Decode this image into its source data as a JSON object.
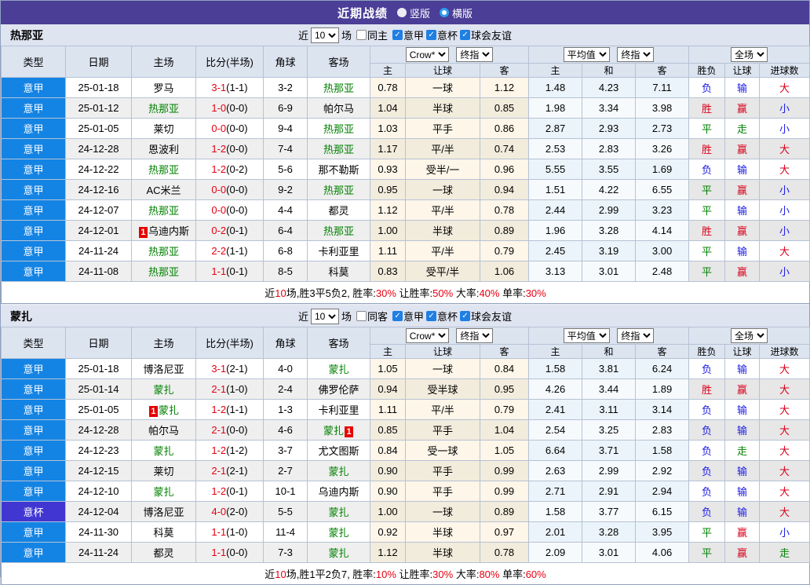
{
  "title_bar": {
    "title": "近期战绩",
    "options": [
      {
        "label": "竖版",
        "selected": true
      },
      {
        "label": "横版",
        "selected": false
      }
    ]
  },
  "table_header": {
    "cols": {
      "type": "类型",
      "date": "日期",
      "home": "主场",
      "score": "比分(半场)",
      "corners": "角球",
      "away": "客场"
    },
    "selects": {
      "crow": "Crow*",
      "final_1": "终指",
      "avg": "平均值",
      "final_2": "终指",
      "full": "全场"
    },
    "sub": {
      "c1": "主",
      "c2": "让球",
      "c3": "客",
      "c4": "主",
      "c5": "和",
      "c6": "客",
      "c7": "胜负",
      "c8": "让球",
      "c9": "进球数"
    }
  },
  "colors": {
    "title_bg": "#4a3e97",
    "focus_team": "#008000",
    "score_red": "#e60012",
    "result_red": "#d9001b",
    "result_blue": "#1a1ae6",
    "result_green": "#008000"
  },
  "league_colors": {
    "意甲": "#1484e4",
    "意杯": "#4236d2"
  },
  "result_colors": {
    "胜": "red",
    "赢": "red",
    "大": "red",
    "负": "blue",
    "输": "blue",
    "小": "blue",
    "平": "green",
    "走": "green"
  },
  "sections": [
    {
      "team": "热那亚",
      "filter": {
        "near": "近",
        "count": "10",
        "games": "场",
        "side_label": "同主",
        "side_checked": false,
        "leagues": [
          {
            "label": "意甲",
            "checked": true
          },
          {
            "label": "意杯",
            "checked": true
          },
          {
            "label": "球会友谊",
            "checked": true
          }
        ]
      },
      "rows": [
        {
          "league": "意甲",
          "date": "25-01-18",
          "home": {
            "name": "罗马",
            "focus": false
          },
          "score": "3-1",
          "half": "(1-1)",
          "corners": "3-2",
          "away": {
            "name": "热那亚",
            "focus": true
          },
          "odds": {
            "home": "0.78",
            "handicap": "一球",
            "away": "1.12"
          },
          "avg": {
            "home": "1.48",
            "draw": "4.23",
            "away": "7.11"
          },
          "results": [
            "负",
            "输",
            "大"
          ]
        },
        {
          "league": "意甲",
          "date": "25-01-12",
          "home": {
            "name": "热那亚",
            "focus": true
          },
          "score": "1-0",
          "half": "(0-0)",
          "corners": "6-9",
          "away": {
            "name": "帕尔马",
            "focus": false
          },
          "odds": {
            "home": "1.04",
            "handicap": "半球",
            "away": "0.85"
          },
          "avg": {
            "home": "1.98",
            "draw": "3.34",
            "away": "3.98"
          },
          "results": [
            "胜",
            "赢",
            "小"
          ]
        },
        {
          "league": "意甲",
          "date": "25-01-05",
          "home": {
            "name": "莱切",
            "focus": false
          },
          "score": "0-0",
          "half": "(0-0)",
          "corners": "9-4",
          "away": {
            "name": "热那亚",
            "focus": true
          },
          "odds": {
            "home": "1.03",
            "handicap": "平手",
            "away": "0.86"
          },
          "avg": {
            "home": "2.87",
            "draw": "2.93",
            "away": "2.73"
          },
          "results": [
            "平",
            "走",
            "小"
          ]
        },
        {
          "league": "意甲",
          "date": "24-12-28",
          "home": {
            "name": "恩波利",
            "focus": false
          },
          "score": "1-2",
          "half": "(0-0)",
          "corners": "7-4",
          "away": {
            "name": "热那亚",
            "focus": true
          },
          "odds": {
            "home": "1.17",
            "handicap": "平/半",
            "away": "0.74"
          },
          "avg": {
            "home": "2.53",
            "draw": "2.83",
            "away": "3.26"
          },
          "results": [
            "胜",
            "赢",
            "大"
          ]
        },
        {
          "league": "意甲",
          "date": "24-12-22",
          "home": {
            "name": "热那亚",
            "focus": true
          },
          "score": "1-2",
          "half": "(0-2)",
          "corners": "5-6",
          "away": {
            "name": "那不勒斯",
            "focus": false
          },
          "odds": {
            "home": "0.93",
            "handicap": "受半/一",
            "away": "0.96"
          },
          "avg": {
            "home": "5.55",
            "draw": "3.55",
            "away": "1.69"
          },
          "results": [
            "负",
            "输",
            "大"
          ]
        },
        {
          "league": "意甲",
          "date": "24-12-16",
          "home": {
            "name": "AC米兰",
            "focus": false
          },
          "score": "0-0",
          "half": "(0-0)",
          "corners": "9-2",
          "away": {
            "name": "热那亚",
            "focus": true
          },
          "odds": {
            "home": "0.95",
            "handicap": "一球",
            "away": "0.94"
          },
          "avg": {
            "home": "1.51",
            "draw": "4.22",
            "away": "6.55"
          },
          "results": [
            "平",
            "赢",
            "小"
          ]
        },
        {
          "league": "意甲",
          "date": "24-12-07",
          "home": {
            "name": "热那亚",
            "focus": true
          },
          "score": "0-0",
          "half": "(0-0)",
          "corners": "4-4",
          "away": {
            "name": "都灵",
            "focus": false
          },
          "odds": {
            "home": "1.12",
            "handicap": "平/半",
            "away": "0.78"
          },
          "avg": {
            "home": "2.44",
            "draw": "2.99",
            "away": "3.23"
          },
          "results": [
            "平",
            "输",
            "小"
          ]
        },
        {
          "league": "意甲",
          "date": "24-12-01",
          "home": {
            "name": "乌迪内斯",
            "focus": false,
            "card": "1",
            "card_pos": "before"
          },
          "score": "0-2",
          "half": "(0-1)",
          "corners": "6-4",
          "away": {
            "name": "热那亚",
            "focus": true
          },
          "odds": {
            "home": "1.00",
            "handicap": "半球",
            "away": "0.89"
          },
          "avg": {
            "home": "1.96",
            "draw": "3.28",
            "away": "4.14"
          },
          "results": [
            "胜",
            "赢",
            "小"
          ]
        },
        {
          "league": "意甲",
          "date": "24-11-24",
          "home": {
            "name": "热那亚",
            "focus": true
          },
          "score": "2-2",
          "half": "(1-1)",
          "corners": "6-8",
          "away": {
            "name": "卡利亚里",
            "focus": false
          },
          "odds": {
            "home": "1.11",
            "handicap": "平/半",
            "away": "0.79"
          },
          "avg": {
            "home": "2.45",
            "draw": "3.19",
            "away": "3.00"
          },
          "results": [
            "平",
            "输",
            "大"
          ]
        },
        {
          "league": "意甲",
          "date": "24-11-08",
          "home": {
            "name": "热那亚",
            "focus": true
          },
          "score": "1-1",
          "half": "(0-1)",
          "corners": "8-5",
          "away": {
            "name": "科莫",
            "focus": false
          },
          "odds": {
            "home": "0.83",
            "handicap": "受平/半",
            "away": "1.06"
          },
          "avg": {
            "home": "3.13",
            "draw": "3.01",
            "away": "2.48"
          },
          "results": [
            "平",
            "赢",
            "小"
          ]
        }
      ],
      "summary": [
        {
          "text": "近"
        },
        {
          "text": "10",
          "red": true
        },
        {
          "text": "场,胜3平5负2, 胜率:"
        },
        {
          "text": "30%",
          "red": true
        },
        {
          "text": " 让胜率:"
        },
        {
          "text": "50%",
          "red": true
        },
        {
          "text": " 大率:"
        },
        {
          "text": "40%",
          "red": true
        },
        {
          "text": " 单率:"
        },
        {
          "text": "30%",
          "red": true
        }
      ]
    },
    {
      "team": "蒙扎",
      "filter": {
        "near": "近",
        "count": "10",
        "games": "场",
        "side_label": "同客",
        "side_checked": false,
        "leagues": [
          {
            "label": "意甲",
            "checked": true
          },
          {
            "label": "意杯",
            "checked": true
          },
          {
            "label": "球会友谊",
            "checked": true
          }
        ]
      },
      "rows": [
        {
          "league": "意甲",
          "date": "25-01-18",
          "home": {
            "name": "博洛尼亚",
            "focus": false
          },
          "score": "3-1",
          "half": "(2-1)",
          "corners": "4-0",
          "away": {
            "name": "蒙扎",
            "focus": true
          },
          "odds": {
            "home": "1.05",
            "handicap": "一球",
            "away": "0.84"
          },
          "avg": {
            "home": "1.58",
            "draw": "3.81",
            "away": "6.24"
          },
          "results": [
            "负",
            "输",
            "大"
          ]
        },
        {
          "league": "意甲",
          "date": "25-01-14",
          "home": {
            "name": "蒙扎",
            "focus": true
          },
          "score": "2-1",
          "half": "(1-0)",
          "corners": "2-4",
          "away": {
            "name": "佛罗伦萨",
            "focus": false
          },
          "odds": {
            "home": "0.94",
            "handicap": "受半球",
            "away": "0.95"
          },
          "avg": {
            "home": "4.26",
            "draw": "3.44",
            "away": "1.89"
          },
          "results": [
            "胜",
            "赢",
            "大"
          ]
        },
        {
          "league": "意甲",
          "date": "25-01-05",
          "home": {
            "name": "蒙扎",
            "focus": true,
            "card": "1",
            "card_pos": "before"
          },
          "score": "1-2",
          "half": "(1-1)",
          "corners": "1-3",
          "away": {
            "name": "卡利亚里",
            "focus": false
          },
          "odds": {
            "home": "1.11",
            "handicap": "平/半",
            "away": "0.79"
          },
          "avg": {
            "home": "2.41",
            "draw": "3.11",
            "away": "3.14"
          },
          "results": [
            "负",
            "输",
            "大"
          ]
        },
        {
          "league": "意甲",
          "date": "24-12-28",
          "home": {
            "name": "帕尔马",
            "focus": false
          },
          "score": "2-1",
          "half": "(0-0)",
          "corners": "4-6",
          "away": {
            "name": "蒙扎",
            "focus": true,
            "card": "1",
            "card_pos": "after"
          },
          "odds": {
            "home": "0.85",
            "handicap": "平手",
            "away": "1.04"
          },
          "avg": {
            "home": "2.54",
            "draw": "3.25",
            "away": "2.83"
          },
          "results": [
            "负",
            "输",
            "大"
          ]
        },
        {
          "league": "意甲",
          "date": "24-12-23",
          "home": {
            "name": "蒙扎",
            "focus": true
          },
          "score": "1-2",
          "half": "(1-2)",
          "corners": "3-7",
          "away": {
            "name": "尤文图斯",
            "focus": false
          },
          "odds": {
            "home": "0.84",
            "handicap": "受一球",
            "away": "1.05"
          },
          "avg": {
            "home": "6.64",
            "draw": "3.71",
            "away": "1.58"
          },
          "results": [
            "负",
            "走",
            "大"
          ]
        },
        {
          "league": "意甲",
          "date": "24-12-15",
          "home": {
            "name": "莱切",
            "focus": false
          },
          "score": "2-1",
          "half": "(2-1)",
          "corners": "2-7",
          "away": {
            "name": "蒙扎",
            "focus": true
          },
          "odds": {
            "home": "0.90",
            "handicap": "平手",
            "away": "0.99"
          },
          "avg": {
            "home": "2.63",
            "draw": "2.99",
            "away": "2.92"
          },
          "results": [
            "负",
            "输",
            "大"
          ]
        },
        {
          "league": "意甲",
          "date": "24-12-10",
          "home": {
            "name": "蒙扎",
            "focus": true
          },
          "score": "1-2",
          "half": "(0-1)",
          "corners": "10-1",
          "away": {
            "name": "乌迪内斯",
            "focus": false
          },
          "odds": {
            "home": "0.90",
            "handicap": "平手",
            "away": "0.99"
          },
          "avg": {
            "home": "2.71",
            "draw": "2.91",
            "away": "2.94"
          },
          "results": [
            "负",
            "输",
            "大"
          ]
        },
        {
          "league": "意杯",
          "date": "24-12-04",
          "home": {
            "name": "博洛尼亚",
            "focus": false
          },
          "score": "4-0",
          "half": "(2-0)",
          "corners": "5-5",
          "away": {
            "name": "蒙扎",
            "focus": true
          },
          "odds": {
            "home": "1.00",
            "handicap": "一球",
            "away": "0.89"
          },
          "avg": {
            "home": "1.58",
            "draw": "3.77",
            "away": "6.15"
          },
          "results": [
            "负",
            "输",
            "大"
          ]
        },
        {
          "league": "意甲",
          "date": "24-11-30",
          "home": {
            "name": "科莫",
            "focus": false
          },
          "score": "1-1",
          "half": "(1-0)",
          "corners": "11-4",
          "away": {
            "name": "蒙扎",
            "focus": true
          },
          "odds": {
            "home": "0.92",
            "handicap": "半球",
            "away": "0.97"
          },
          "avg": {
            "home": "2.01",
            "draw": "3.28",
            "away": "3.95"
          },
          "results": [
            "平",
            "赢",
            "小"
          ]
        },
        {
          "league": "意甲",
          "date": "24-11-24",
          "home": {
            "name": "都灵",
            "focus": false
          },
          "score": "1-1",
          "half": "(0-0)",
          "corners": "7-3",
          "away": {
            "name": "蒙扎",
            "focus": true
          },
          "odds": {
            "home": "1.12",
            "handicap": "半球",
            "away": "0.78"
          },
          "avg": {
            "home": "2.09",
            "draw": "3.01",
            "away": "4.06"
          },
          "results": [
            "平",
            "赢",
            "走"
          ]
        }
      ],
      "summary": [
        {
          "text": "近"
        },
        {
          "text": "10",
          "red": true
        },
        {
          "text": "场,胜1平2负7, 胜率:"
        },
        {
          "text": "10%",
          "red": true
        },
        {
          "text": " 让胜率:"
        },
        {
          "text": "30%",
          "red": true
        },
        {
          "text": " 大率:"
        },
        {
          "text": "80%",
          "red": true
        },
        {
          "text": " 单率:"
        },
        {
          "text": "60%",
          "red": true
        }
      ]
    }
  ]
}
